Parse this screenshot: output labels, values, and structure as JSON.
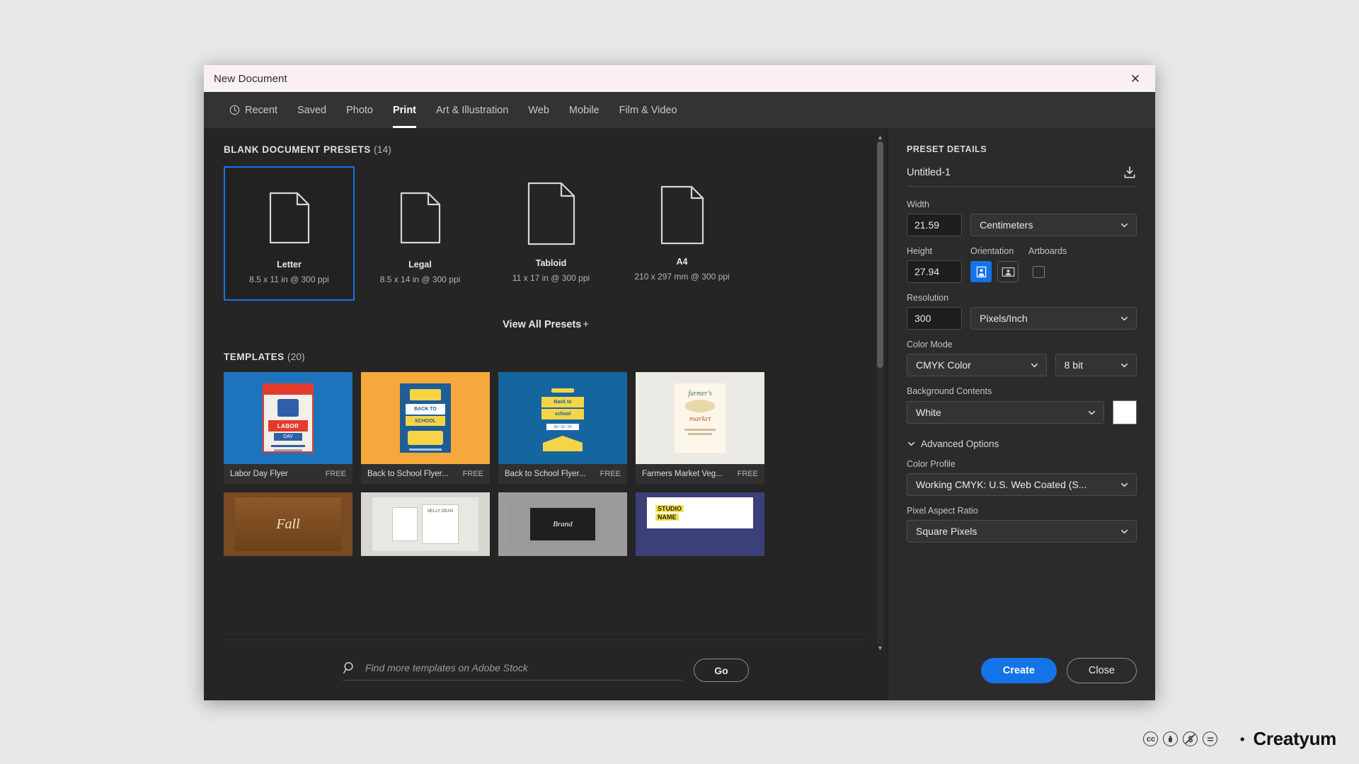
{
  "window": {
    "title": "New Document",
    "close_label": "✕"
  },
  "tabs": [
    {
      "label": "Recent",
      "icon": "clock-icon",
      "active": false
    },
    {
      "label": "Saved",
      "icon": "",
      "active": false
    },
    {
      "label": "Photo",
      "icon": "",
      "active": false
    },
    {
      "label": "Print",
      "icon": "",
      "active": true
    },
    {
      "label": "Art & Illustration",
      "icon": "",
      "active": false
    },
    {
      "label": "Web",
      "icon": "",
      "active": false
    },
    {
      "label": "Mobile",
      "icon": "",
      "active": false
    },
    {
      "label": "Film & Video",
      "icon": "",
      "active": false
    }
  ],
  "presets_section": {
    "title": "BLANK DOCUMENT PRESETS",
    "count": "(14)",
    "items": [
      {
        "name": "Letter",
        "spec": "8.5 x 11 in @ 300 ppi",
        "selected": true
      },
      {
        "name": "Legal",
        "spec": "8.5 x 14 in @ 300 ppi",
        "selected": false
      },
      {
        "name": "Tabloid",
        "spec": "11 x 17 in @ 300 ppi",
        "selected": false
      },
      {
        "name": "A4",
        "spec": "210 x 297 mm @ 300 ppi",
        "selected": false
      }
    ],
    "view_all_label": "View All Presets",
    "view_all_plus": "+"
  },
  "templates_section": {
    "title": "TEMPLATES",
    "count": "(20)",
    "free_label": "FREE",
    "items": [
      {
        "name": "Labor Day Flyer",
        "free": "FREE",
        "art": "labor-day",
        "bg": "#1d74bd"
      },
      {
        "name": "Back to School Flyer...",
        "free": "FREE",
        "art": "bus",
        "bg": "#f5a93c"
      },
      {
        "name": "Back to School Flyer...",
        "free": "FREE",
        "art": "school",
        "bg": "#15659e"
      },
      {
        "name": "Farmers Market Veg...",
        "free": "FREE",
        "art": "farmers",
        "bg": "#eceae5"
      },
      {
        "name": "",
        "free": "",
        "art": "fall",
        "bg": "#7a4a22"
      },
      {
        "name": "",
        "free": "",
        "art": "nelly",
        "bg": "#d8d6d1"
      },
      {
        "name": "",
        "free": "",
        "art": "brand",
        "bg": "#9c9c9c"
      },
      {
        "name": "",
        "free": "",
        "art": "studio",
        "bg": "#3d3f79"
      }
    ]
  },
  "search": {
    "placeholder": "Find more templates on Adobe Stock",
    "value": "",
    "go_label": "Go",
    "icon": "search-icon"
  },
  "preset_details": {
    "header": "PRESET DETAILS",
    "doc_name": "Untitled-1",
    "save_icon": "save-preset-icon",
    "width": {
      "label": "Width",
      "value": "21.59",
      "unit": "Centimeters"
    },
    "height": {
      "label": "Height",
      "value": "27.94"
    },
    "orientation": {
      "label": "Orientation",
      "portrait_selected": true,
      "landscape_selected": false
    },
    "artboards": {
      "label": "Artboards",
      "checked": false
    },
    "resolution": {
      "label": "Resolution",
      "value": "300",
      "unit": "Pixels/Inch"
    },
    "color_mode": {
      "label": "Color Mode",
      "value": "CMYK Color",
      "depth": "8 bit"
    },
    "background": {
      "label": "Background Contents",
      "value": "White",
      "swatch": "#ffffff"
    },
    "advanced_options": {
      "label": "Advanced Options",
      "expanded": true
    },
    "color_profile": {
      "label": "Color Profile",
      "value": "Working CMYK: U.S. Web Coated (S..."
    },
    "pixel_aspect_ratio": {
      "label": "Pixel Aspect Ratio",
      "value": "Square Pixels"
    }
  },
  "actions": {
    "create_label": "Create",
    "close_label": "Close"
  },
  "watermark": {
    "badges": [
      "cc",
      "by",
      "nc",
      "nd"
    ],
    "brand": "Creatyum"
  },
  "colors": {
    "accent": "#1473e6",
    "dialog_bg": "#252525",
    "panel_bg": "#2b2b2b",
    "titlebar_bg": "#faf0f1"
  }
}
